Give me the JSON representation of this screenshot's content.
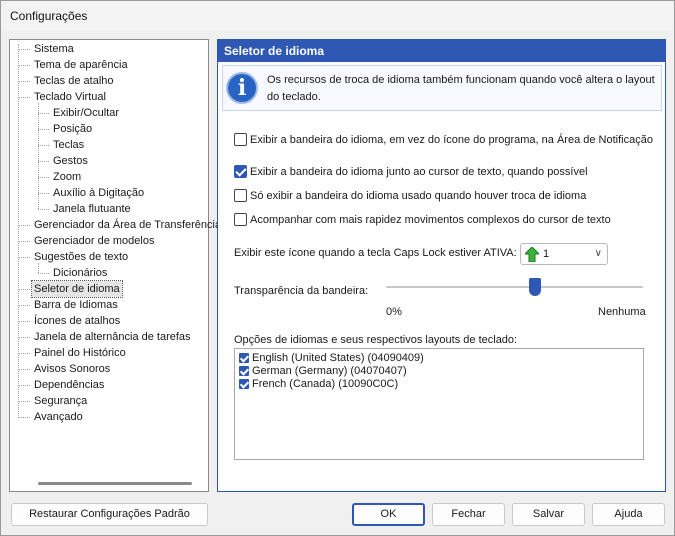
{
  "window": {
    "title": "Configurações"
  },
  "tree": {
    "items": [
      {
        "label": "Sistema",
        "level": 0
      },
      {
        "label": "Tema de aparência",
        "level": 0
      },
      {
        "label": "Teclas de atalho",
        "level": 0
      },
      {
        "label": "Teclado Virtual",
        "level": 0
      },
      {
        "label": "Exibir/Ocultar",
        "level": 1
      },
      {
        "label": "Posição",
        "level": 1
      },
      {
        "label": "Teclas",
        "level": 1
      },
      {
        "label": "Gestos",
        "level": 1
      },
      {
        "label": "Zoom",
        "level": 1
      },
      {
        "label": "Auxílio à Digitação",
        "level": 1
      },
      {
        "label": "Janela flutuante",
        "level": 1
      },
      {
        "label": "Gerenciador da Área de Transferência",
        "level": 0
      },
      {
        "label": "Gerenciador de modelos",
        "level": 0
      },
      {
        "label": "Sugestões de texto",
        "level": 0
      },
      {
        "label": "Dicionários",
        "level": 1
      },
      {
        "label": "Seletor de idioma",
        "level": 0,
        "selected": true
      },
      {
        "label": "Barra de Idiomas",
        "level": 0
      },
      {
        "label": "Ícones de atalhos",
        "level": 0
      },
      {
        "label": "Janela de alternância de tarefas",
        "level": 0
      },
      {
        "label": "Painel do Histórico",
        "level": 0
      },
      {
        "label": "Avisos Sonoros",
        "level": 0
      },
      {
        "label": "Dependências",
        "level": 0
      },
      {
        "label": "Segurança",
        "level": 0
      },
      {
        "label": "Avançado",
        "level": 0
      }
    ]
  },
  "panel": {
    "title": "Seletor de idioma",
    "info_text": "Os recursos de troca de idioma também funcionam quando você altera o layout do teclado.",
    "info_icon": "info-icon",
    "options": [
      {
        "label": "Exibir a bandeira do idioma, em vez do ícone do programa, na Área de Notificação",
        "checked": false
      },
      {
        "label": "Exibir a bandeira do idioma junto ao cursor de texto, quando possível",
        "checked": true
      },
      {
        "label": "Só exibir a bandeira do idioma usado quando houver troca de idioma",
        "checked": false
      },
      {
        "label": "Acompanhar com mais rapidez movimentos complexos do cursor de texto",
        "checked": false
      }
    ],
    "caps_lock_label": "Exibir este ícone quando a tecla Caps Lock estiver ATIVA:",
    "caps_lock_value": "1",
    "caps_lock_icon": "green-up-arrow-icon",
    "transparency_label": "Transparência da bandeira:",
    "transparency_min": "0%",
    "transparency_max": "Nenhuma",
    "transparency_value": 0.58,
    "languages_label": "Opções de idiomas e seus respectivos layouts de teclado:",
    "languages": [
      {
        "label": "English (United States) (04090409)",
        "checked": true
      },
      {
        "label": "German (Germany) (04070407)",
        "checked": true
      },
      {
        "label": "French (Canada) (10090C0C)",
        "checked": true
      }
    ]
  },
  "buttons": {
    "restore": "Restaurar Configurações Padrão",
    "ok": "OK",
    "close": "Fechar",
    "save": "Salvar",
    "help": "Ajuda"
  },
  "colors": {
    "accent": "#2f58b4",
    "window_bg": "#f0f0f0"
  }
}
